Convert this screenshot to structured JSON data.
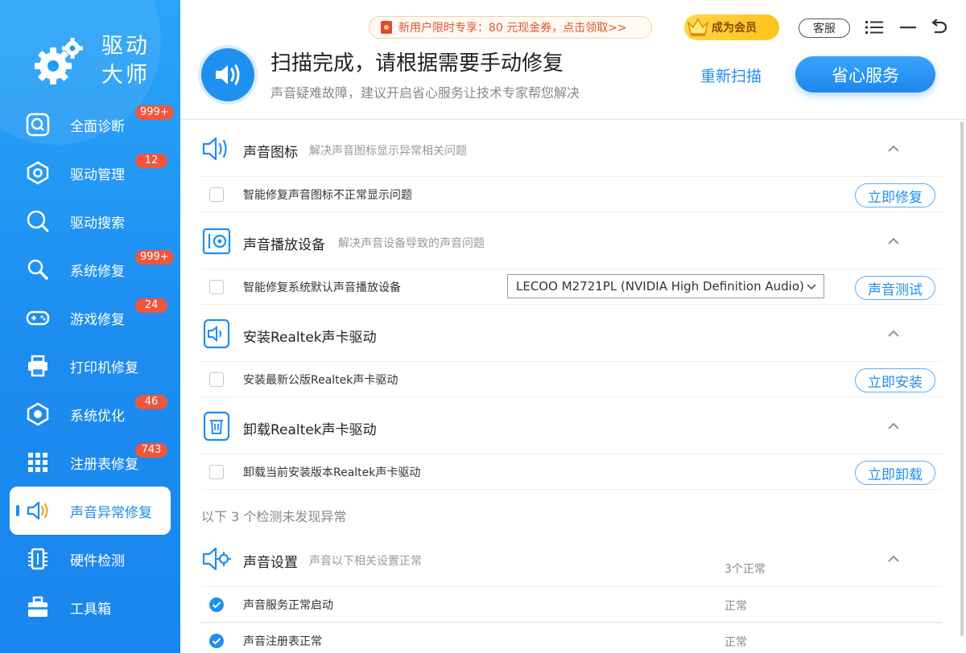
{
  "app": {
    "title_line1": "驱动",
    "title_line2": "大师"
  },
  "sidebar": {
    "items": [
      {
        "label": "全面诊断",
        "badge": "999+",
        "icon": "diagnosis-icon"
      },
      {
        "label": "驱动管理",
        "badge": "12",
        "icon": "driver-hex-icon"
      },
      {
        "label": "驱动搜索",
        "badge": "",
        "icon": "search-icon"
      },
      {
        "label": "系统修复",
        "badge": "999+",
        "icon": "wrench-icon"
      },
      {
        "label": "游戏修复",
        "badge": "24",
        "icon": "gamepad-icon"
      },
      {
        "label": "打印机修复",
        "badge": "",
        "icon": "printer-icon"
      },
      {
        "label": "系统优化",
        "badge": "46",
        "icon": "optimize-icon"
      },
      {
        "label": "注册表修复",
        "badge": "743",
        "icon": "grid-icon"
      },
      {
        "label": "声音异常修复",
        "badge": "",
        "icon": "speaker-icon",
        "active": true
      },
      {
        "label": "硬件检测",
        "badge": "",
        "icon": "chip-icon"
      },
      {
        "label": "工具箱",
        "badge": "",
        "icon": "toolbox-icon"
      }
    ]
  },
  "topbar": {
    "promo": "新用户限时专享：80 元现金券，点击领取>>",
    "vip": "成为会员",
    "service": "客服"
  },
  "header": {
    "title": "扫描完成，请根据需要手动修复",
    "subtitle": "声音疑难故障，建议开启省心服务让技术专家帮您解决",
    "rescan": "重新扫描",
    "main_button": "省心服务"
  },
  "sections": [
    {
      "title": "声音图标",
      "desc": "解决声音图标显示异常相关问题",
      "icon": "speaker-outline-icon",
      "row": {
        "label": "智能修复声音图标不正常显示问题",
        "button": "立即修复"
      }
    },
    {
      "title": "声音播放设备",
      "desc": "解决声音设备导致的声音问题",
      "icon": "audio-device-icon",
      "row": {
        "label": "智能修复系统默认声音播放设备",
        "button": "声音测试",
        "select": "LECOO M2721PL (NVIDIA High Definition Audio)"
      }
    },
    {
      "title": "安装Realtek声卡驱动",
      "desc": "",
      "icon": "soundcard-install-icon",
      "row": {
        "label": "安装最新公版Realtek声卡驱动",
        "button": "立即安装"
      }
    },
    {
      "title": "卸载Realtek声卡驱动",
      "desc": "",
      "icon": "trash-icon",
      "row": {
        "label": "卸载当前安装版本Realtek声卡驱动",
        "button": "立即卸载"
      }
    }
  ],
  "normal_note": "以下 3 个检测未发现异常",
  "normal_section": {
    "title": "声音设置",
    "desc": "声音以下相关设置正常",
    "count": "3个正常",
    "icon": "sound-settings-icon",
    "rows": [
      {
        "label": "声音服务正常启动",
        "status": "正常"
      },
      {
        "label": "声音注册表正常",
        "status": "正常"
      }
    ]
  },
  "colors": {
    "accent": "#1f8ef0",
    "badge": "#f0553e",
    "vip": "#ffc21a"
  }
}
